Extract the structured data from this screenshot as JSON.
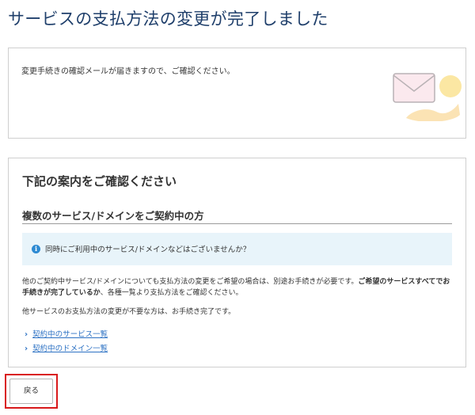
{
  "page": {
    "title": "サービスの支払方法の変更が完了しました"
  },
  "notice_box": {
    "message": "変更手続きの確認メールが届きますので、ご確認ください。",
    "illustration_icon": "mail-envelope-icon"
  },
  "guide_box": {
    "title": "下記の案内をご確認ください",
    "subtitle": "複数のサービス/ドメインをご契約中の方",
    "info": {
      "icon": "info-icon",
      "text": "同時にご利用中のサービス/ドメインなどはございませんか？"
    },
    "paragraph1_normal": "他のご契約中サービス/ドメインについても支払方法の変更をご希望の場合は、別途お手続きが必要です。",
    "paragraph1_bold": "ご希望のサービスすべてでお手続きが完了しているか",
    "paragraph1_tail": "、各種一覧より支払方法をご確認ください。",
    "paragraph2": "他サービスのお支払方法の変更が不要な方は、お手続き完了です。",
    "links": [
      {
        "label": "契約中のサービス一覧"
      },
      {
        "label": "契約中のドメイン一覧"
      }
    ]
  },
  "actions": {
    "back_label": "戻る"
  },
  "colors": {
    "title": "#1f3f6b",
    "link": "#2d72c4",
    "info_bg": "#e8f4fa",
    "highlight": "#d9191b"
  }
}
